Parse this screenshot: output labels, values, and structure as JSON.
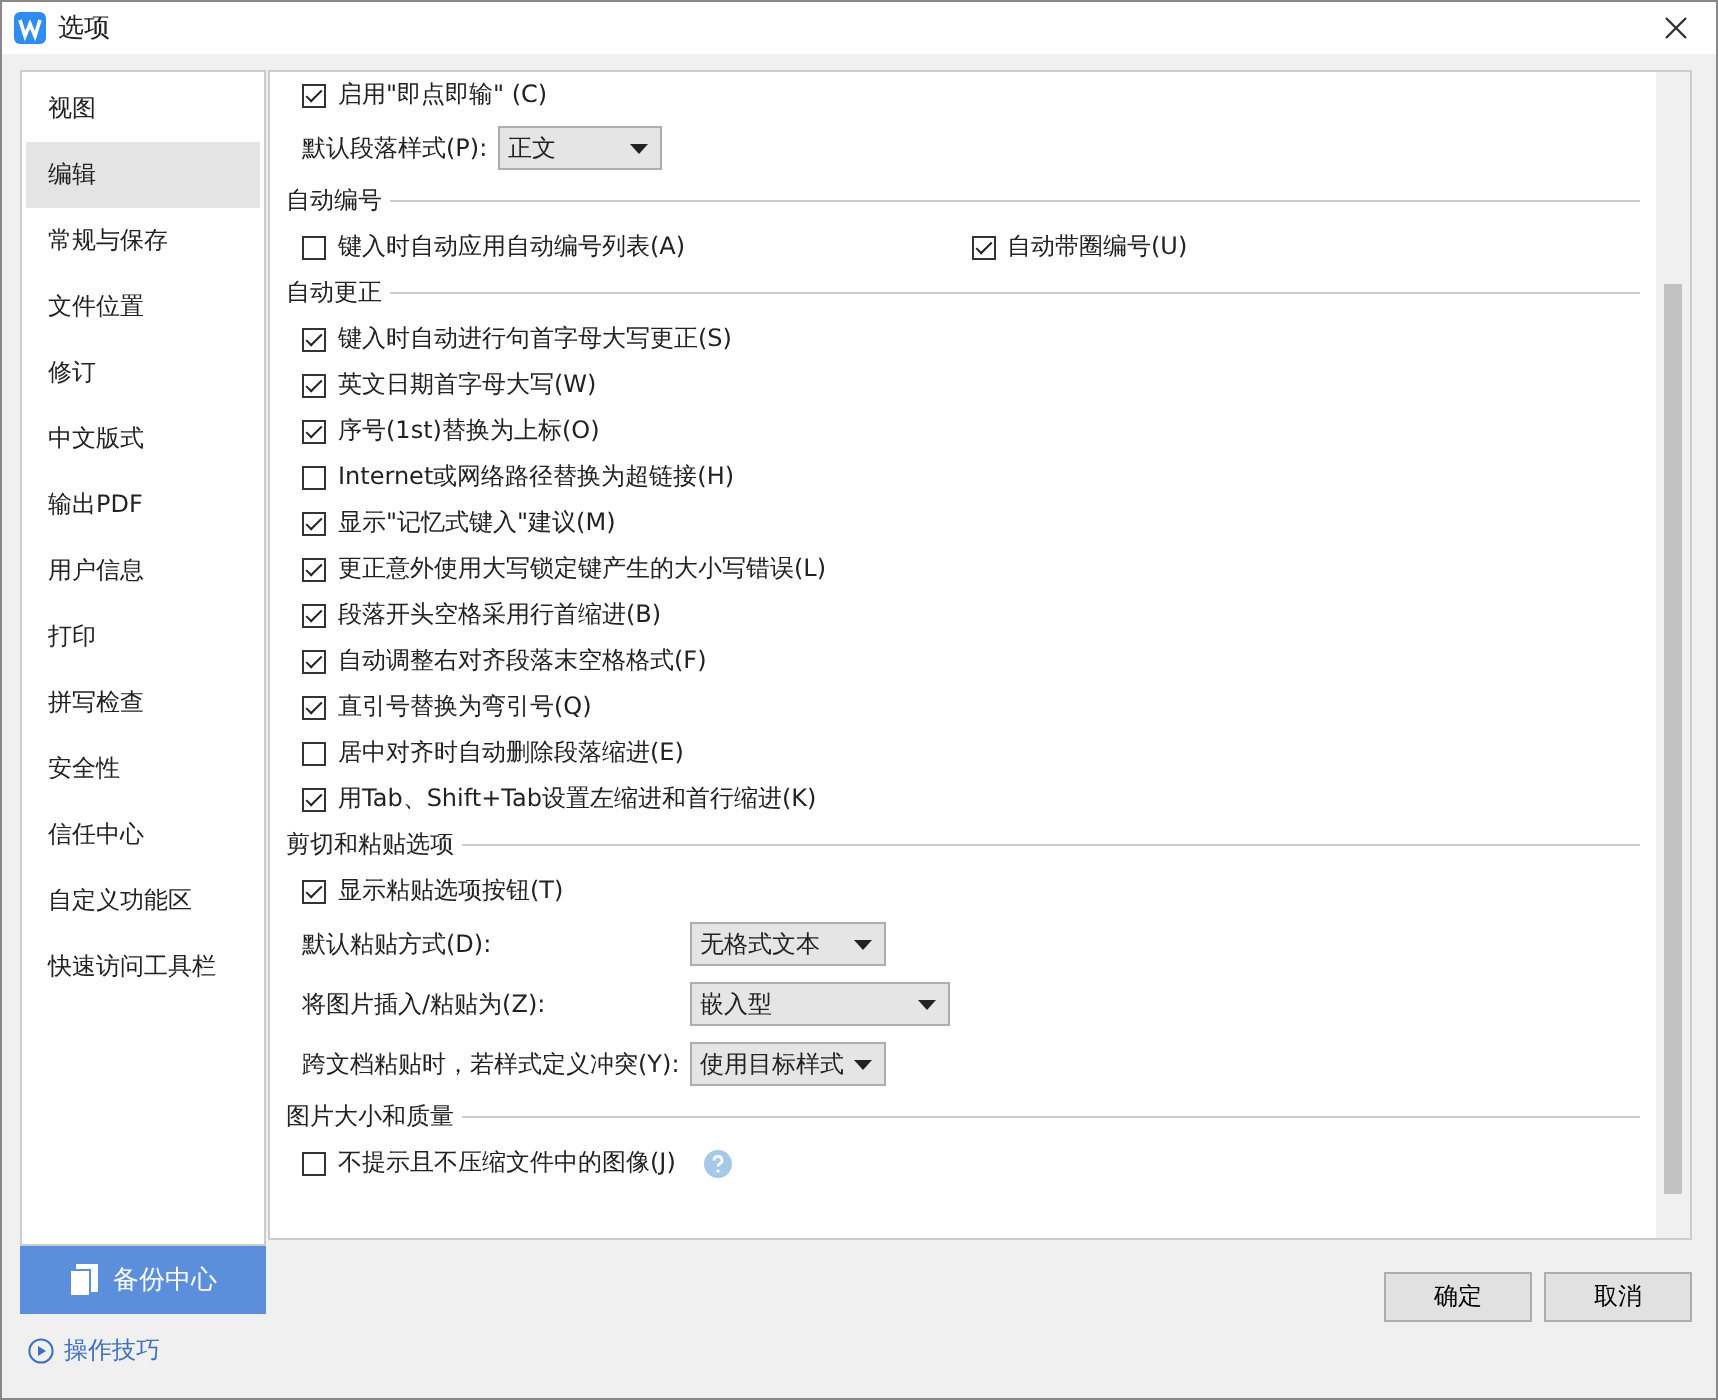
{
  "window": {
    "title": "选项"
  },
  "sidebar": {
    "items": [
      {
        "label": "视图",
        "selected": false
      },
      {
        "label": "编辑",
        "selected": true
      },
      {
        "label": "常规与保存",
        "selected": false
      },
      {
        "label": "文件位置",
        "selected": false
      },
      {
        "label": "修订",
        "selected": false
      },
      {
        "label": "中文版式",
        "selected": false
      },
      {
        "label": "输出PDF",
        "selected": false
      },
      {
        "label": "用户信息",
        "selected": false
      },
      {
        "label": "打印",
        "selected": false
      },
      {
        "label": "拼写检查",
        "selected": false
      },
      {
        "label": "安全性",
        "selected": false
      },
      {
        "label": "信任中心",
        "selected": false
      },
      {
        "label": "自定义功能区",
        "selected": false
      },
      {
        "label": "快速访问工具栏",
        "selected": false
      }
    ],
    "backup_button": "备份中心",
    "tips_link": "操作技巧"
  },
  "content": [
    {
      "kind": "checkbox",
      "label": "启用\"即点即输\" (C)",
      "checked": true
    },
    {
      "kind": "select",
      "label": "默认段落样式(P):",
      "value": "正文"
    },
    {
      "kind": "heading",
      "label": "自动编号"
    },
    {
      "kind": "pair",
      "items": [
        {
          "label": "键入时自动应用自动编号列表(A)",
          "checked": false
        },
        {
          "label": "自动带圈编号(U)",
          "checked": true
        }
      ]
    },
    {
      "kind": "heading",
      "label": "自动更正"
    },
    {
      "kind": "checkbox",
      "label": "键入时自动进行句首字母大写更正(S)",
      "checked": true
    },
    {
      "kind": "checkbox",
      "label": "英文日期首字母大写(W)",
      "checked": true
    },
    {
      "kind": "checkbox",
      "label": "序号(1st)替换为上标(O)",
      "checked": true
    },
    {
      "kind": "checkbox",
      "label": "Internet或网络路径替换为超链接(H)",
      "checked": false
    },
    {
      "kind": "checkbox",
      "label": "显示\"记忆式键入\"建议(M)",
      "checked": true
    },
    {
      "kind": "checkbox",
      "label": "更正意外使用大写锁定键产生的大小写错误(L)",
      "checked": true
    },
    {
      "kind": "checkbox",
      "label": "段落开头空格采用行首缩进(B)",
      "checked": true
    },
    {
      "kind": "checkbox",
      "label": "自动调整右对齐段落末空格格式(F)",
      "checked": true
    },
    {
      "kind": "checkbox",
      "label": "直引号替换为弯引号(Q)",
      "checked": true
    },
    {
      "kind": "checkbox",
      "label": "居中对齐时自动删除段落缩进(E)",
      "checked": false
    },
    {
      "kind": "checkbox",
      "label": "用Tab、Shift+Tab设置左缩进和首行缩进(K)",
      "checked": true
    },
    {
      "kind": "heading",
      "label": "剪切和粘贴选项"
    },
    {
      "kind": "checkbox",
      "label": "显示粘贴选项按钮(T)",
      "checked": true
    },
    {
      "kind": "select",
      "label": "默认粘贴方式(D):",
      "value": "无格式文本"
    },
    {
      "kind": "select",
      "label": "将图片插入/粘贴为(Z):",
      "value": "嵌入型"
    },
    {
      "kind": "select",
      "label": "跨文档粘贴时，若样式定义冲突(Y):",
      "value": "使用目标样式"
    },
    {
      "kind": "heading",
      "label": "图片大小和质量"
    },
    {
      "kind": "checkbox",
      "label": "不提示且不压缩文件中的图像(J)",
      "checked": false,
      "help": true
    }
  ],
  "buttons": [
    "确定",
    "取消"
  ]
}
